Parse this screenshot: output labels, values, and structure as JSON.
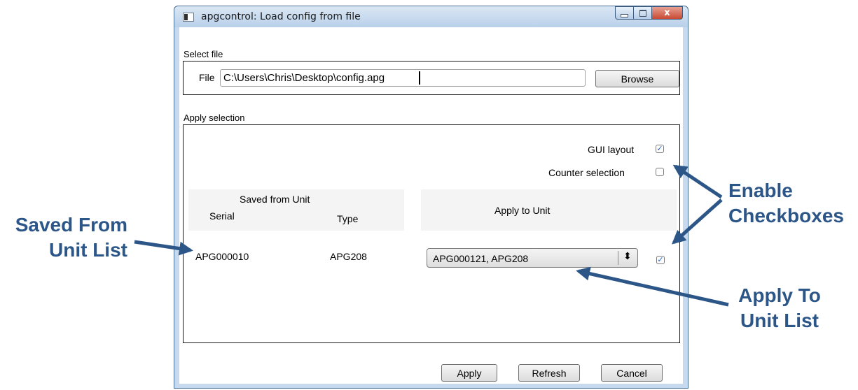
{
  "window": {
    "title": "apgcontrol: Load config from file",
    "close_glyph": "x"
  },
  "select_file": {
    "group_label": "Select file",
    "file_label": "File",
    "file_value": "C:\\Users\\Chris\\Desktop\\config.apg",
    "browse_label": "Browse"
  },
  "apply_selection": {
    "group_label": "Apply selection",
    "gui_layout_label": "GUI layout",
    "gui_layout_checked": true,
    "counter_selection_label": "Counter selection",
    "counter_selection_checked": false,
    "saved_from_unit_header": "Saved from Unit",
    "serial_header": "Serial",
    "type_header": "Type",
    "apply_to_unit_header": "Apply to Unit",
    "rows": [
      {
        "serial": "APG000010",
        "type": "APG208",
        "apply_to": "APG000121, APG208",
        "enabled": true
      }
    ],
    "select_arrow_glyph": "⬍"
  },
  "buttons": {
    "apply": "Apply",
    "refresh": "Refresh",
    "cancel": "Cancel"
  },
  "annotations": {
    "saved_from_line1": "Saved From",
    "saved_from_line2": "Unit List",
    "enable_line1": "Enable",
    "enable_line2": "Checkboxes",
    "apply_to_line1": "Apply To",
    "apply_to_line2": "Unit List"
  },
  "colors": {
    "annotation": "#2c5687",
    "check": "#2163c0"
  },
  "icons": [
    "app-icon",
    "minimize-icon",
    "maximize-icon",
    "close-icon",
    "checkmark-icon",
    "select-arrows-icon",
    "annotation-arrow-icon"
  ]
}
